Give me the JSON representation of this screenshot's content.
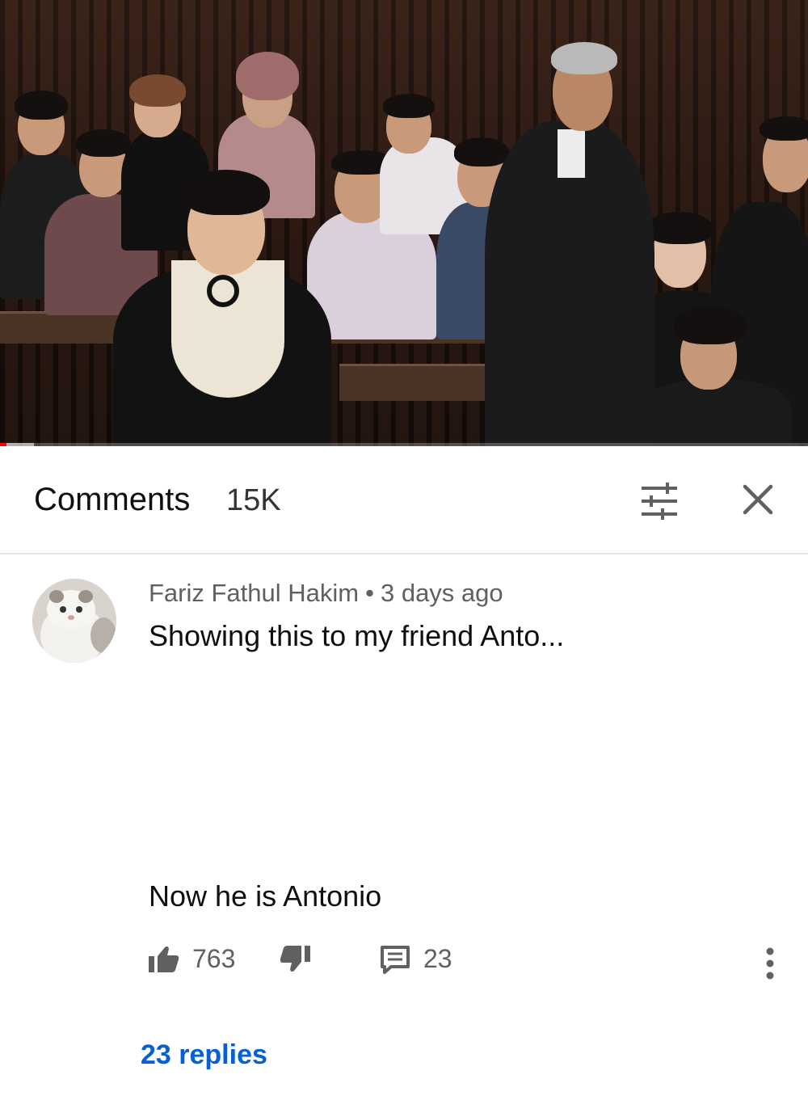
{
  "video": {
    "progress_fraction": 0.008,
    "buffer_fraction": 0.042
  },
  "comments_header": {
    "title": "Comments",
    "count": "15K",
    "filter_icon": "sort-filter-icon",
    "close_icon": "close-icon"
  },
  "comment": {
    "author": "Fariz Fathul Hakim",
    "separator": "•",
    "time": "3 days ago",
    "text_line1": "Showing this to my friend Anto...",
    "text_line2": "Now he is Antonio",
    "likes": "763",
    "reply_count": "23",
    "like_icon": "thumbs-up-icon",
    "dislike_icon": "thumbs-down-icon",
    "reply_icon": "comment-icon",
    "more_icon": "more-vertical-icon",
    "replies_link": "23 replies"
  },
  "colors": {
    "link_blue": "#065fd4",
    "progress_red": "#ff0000",
    "meta_gray": "#606060"
  }
}
